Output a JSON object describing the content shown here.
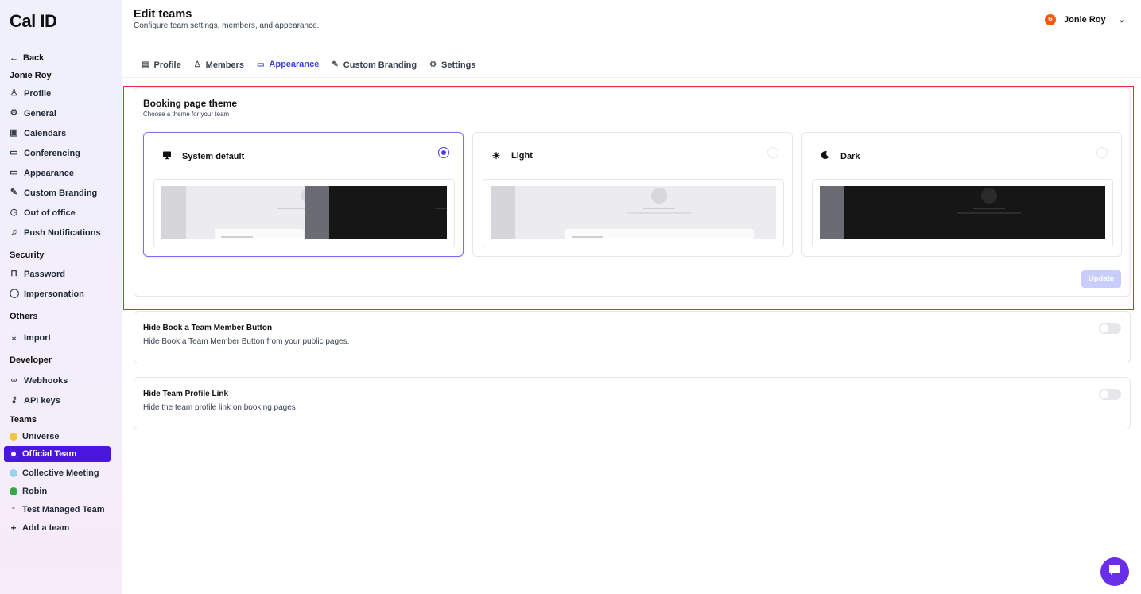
{
  "sidebar": {
    "logo": "Cal ID",
    "back": "Back",
    "user_section": "Jonie Roy",
    "user_items": [
      {
        "label": "Profile",
        "icon": "user-icon",
        "glyph": "♙"
      },
      {
        "label": "General",
        "icon": "gear-icon",
        "glyph": "⚙"
      },
      {
        "label": "Calendars",
        "icon": "calendar-icon",
        "glyph": "▣"
      },
      {
        "label": "Conferencing",
        "icon": "video-icon",
        "glyph": "▭"
      },
      {
        "label": "Appearance",
        "icon": "monitor-icon",
        "glyph": "▭"
      },
      {
        "label": "Custom Branding",
        "icon": "brush-icon",
        "glyph": "✎"
      },
      {
        "label": "Out of office",
        "icon": "clock-icon",
        "glyph": "◷"
      },
      {
        "label": "Push Notifications",
        "icon": "bell-icon",
        "glyph": "♫"
      }
    ],
    "security_title": "Security",
    "security_items": [
      {
        "label": "Password",
        "icon": "lock-icon",
        "glyph": "⊓"
      },
      {
        "label": "Impersonation",
        "icon": "shield-icon",
        "glyph": "◯"
      }
    ],
    "others_title": "Others",
    "others_items": [
      {
        "label": "Import",
        "icon": "download-icon",
        "glyph": "⤓"
      }
    ],
    "developer_title": "Developer",
    "developer_items": [
      {
        "label": "Webhooks",
        "icon": "webhook-icon",
        "glyph": "∞"
      },
      {
        "label": "API keys",
        "icon": "key-icon",
        "glyph": "⚷"
      }
    ],
    "teams_title": "Teams",
    "teams": [
      {
        "label": "Universe",
        "icon": "team-universe-icon",
        "color": "#f4c542"
      },
      {
        "label": "Official Team",
        "icon": "team-official-icon",
        "color": "#ffffff"
      },
      {
        "label": "Collective Meeting",
        "icon": "team-collective-icon",
        "color": "#9bd1f0"
      },
      {
        "label": "Robin",
        "icon": "team-robin-icon",
        "color": "#3aa64a"
      },
      {
        "label": "Test Managed Team",
        "icon": "team-managed-icon",
        "color": "#333333"
      }
    ],
    "add_team": "Add a team"
  },
  "header": {
    "title": "Edit teams",
    "subtitle": "Configure team settings, members, and appearance.",
    "user_name": "Jonie Roy",
    "avatar_letter": "G",
    "avatar_color": "#f15a0c"
  },
  "tabs": [
    {
      "label": "Profile",
      "icon": "profile-tab-icon",
      "glyph": "▤"
    },
    {
      "label": "Members",
      "icon": "members-tab-icon",
      "glyph": "♙"
    },
    {
      "label": "Appearance",
      "icon": "monitor-tab-icon",
      "glyph": "▭"
    },
    {
      "label": "Custom Branding",
      "icon": "brush-tab-icon",
      "glyph": "✎"
    },
    {
      "label": "Settings",
      "icon": "gear-tab-icon",
      "glyph": "⚙"
    }
  ],
  "active_tab": "Appearance",
  "theme": {
    "title": "Booking page theme",
    "subtitle": "Choose a theme for your team",
    "options": [
      {
        "label": "System default",
        "icon": "monitor-icon",
        "glyph": "🖵",
        "selected": true
      },
      {
        "label": "Light",
        "icon": "sun-icon",
        "glyph": "☀",
        "selected": false
      },
      {
        "label": "Dark",
        "icon": "moon-icon",
        "glyph": "☾",
        "selected": false
      }
    ],
    "update_label": "Update"
  },
  "settings": [
    {
      "title": "Hide Book a Team Member Button",
      "description": "Hide Book a Team Member Button from your public pages.",
      "enabled": false
    },
    {
      "title": "Hide Team Profile Link",
      "description": "Hide the team profile link on booking pages",
      "enabled": false
    }
  ],
  "colors": {
    "accent": "#4a15e0",
    "highlight_border": "#e0313b"
  }
}
